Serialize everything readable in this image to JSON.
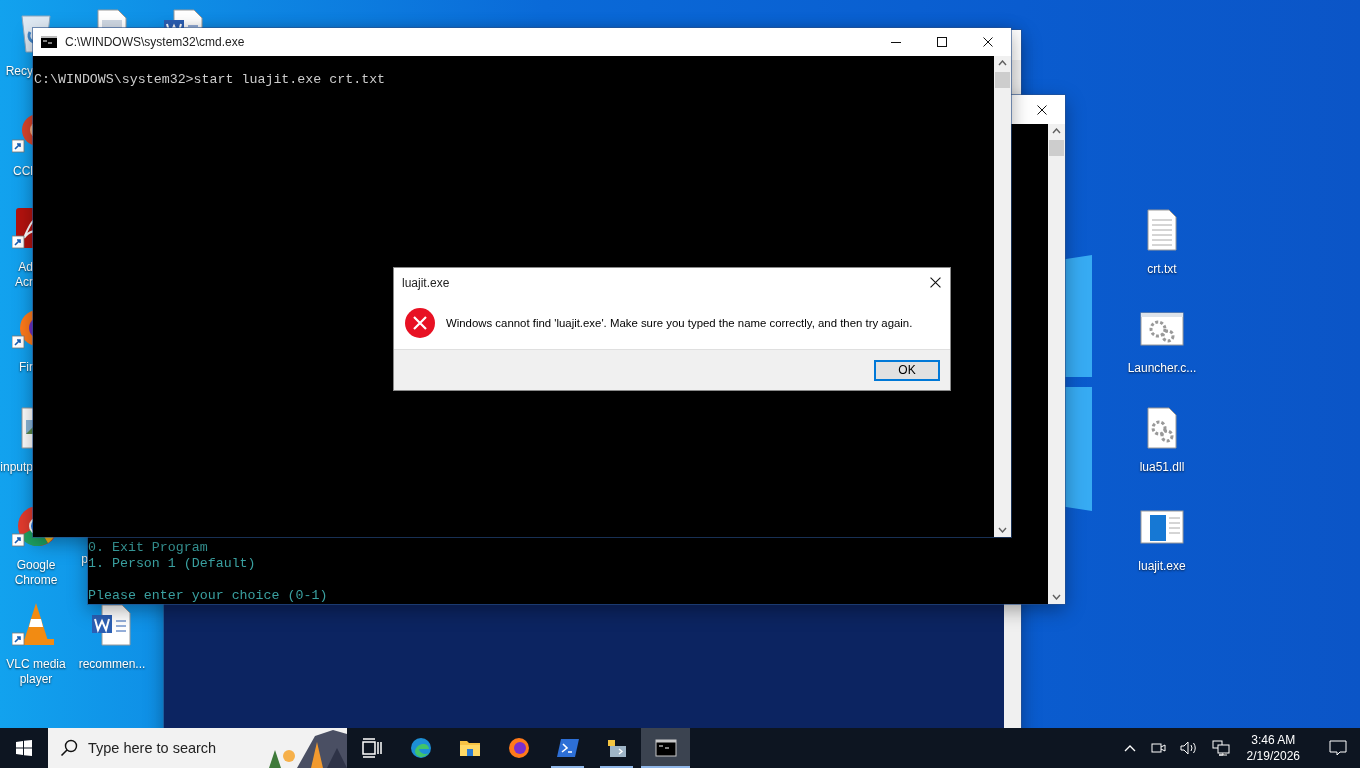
{
  "desktop": {
    "icons": [
      {
        "kind": "recycle-bin",
        "label_lines": [
          "Recy"
        ]
      },
      {
        "kind": "file"
      },
      {
        "kind": "word-doc"
      },
      {
        "kind": "ccleaner",
        "label_lines": [
          "CCl"
        ]
      },
      {
        "kind": "acrobat",
        "label_lines": [
          "Ad",
          "Acr"
        ]
      },
      {
        "kind": "firefox",
        "label_lines": [
          "Fir"
        ]
      },
      {
        "kind": "image-file",
        "label_lines": [
          "inputp"
        ]
      },
      {
        "kind": "chrome",
        "label_lines": [
          "Google",
          "Chrome"
        ]
      },
      {
        "kind": "hidden",
        "label_lines": [
          "p"
        ]
      },
      {
        "kind": "vlc",
        "label_lines": [
          "VLC media",
          "player"
        ]
      },
      {
        "kind": "word-doc",
        "label_lines": [
          "recommen..."
        ]
      },
      {
        "kind": "text-file",
        "label_lines": [
          "crt.txt"
        ]
      },
      {
        "kind": "gears-window",
        "label_lines": [
          "Launcher.c..."
        ]
      },
      {
        "kind": "gears-file",
        "label_lines": [
          "lua51.dll"
        ]
      },
      {
        "kind": "program-window",
        "label_lines": [
          "luajit.exe"
        ]
      }
    ]
  },
  "background_console": {
    "lines": [
      {
        "text": "0. Exit Program",
        "blank_before": false
      },
      {
        "text": "1. Person 1 (Default)",
        "blank_before": false
      },
      {
        "text": "Please enter your choice (0-1)",
        "blank_before": true
      }
    ]
  },
  "cmd_window": {
    "title": "C:\\WINDOWS\\system32\\cmd.exe",
    "lines": [
      "C:\\WINDOWS\\system32>start luajit.exe crt.txt"
    ]
  },
  "dialog": {
    "title": "luajit.exe",
    "message": "Windows cannot find 'luajit.exe'. Make sure you typed the name correctly, and then try again.",
    "buttons": [
      {
        "label": "OK",
        "selected": true
      }
    ]
  },
  "taskbar": {
    "search": {
      "placeholder": "Type here to search"
    },
    "apps": [
      {
        "kind": "task-view",
        "running": false,
        "selected": false
      },
      {
        "kind": "edge",
        "running": false,
        "selected": false
      },
      {
        "kind": "explorer",
        "running": false,
        "selected": false
      },
      {
        "kind": "firefox",
        "running": false,
        "selected": false
      },
      {
        "kind": "powershell",
        "running": true,
        "selected": false
      },
      {
        "kind": "python-folder",
        "running": true,
        "selected": false
      },
      {
        "kind": "cmd",
        "running": true,
        "selected": true
      }
    ],
    "clock": {
      "time": "3:46 AM",
      "date": "2/19/2026"
    }
  }
}
